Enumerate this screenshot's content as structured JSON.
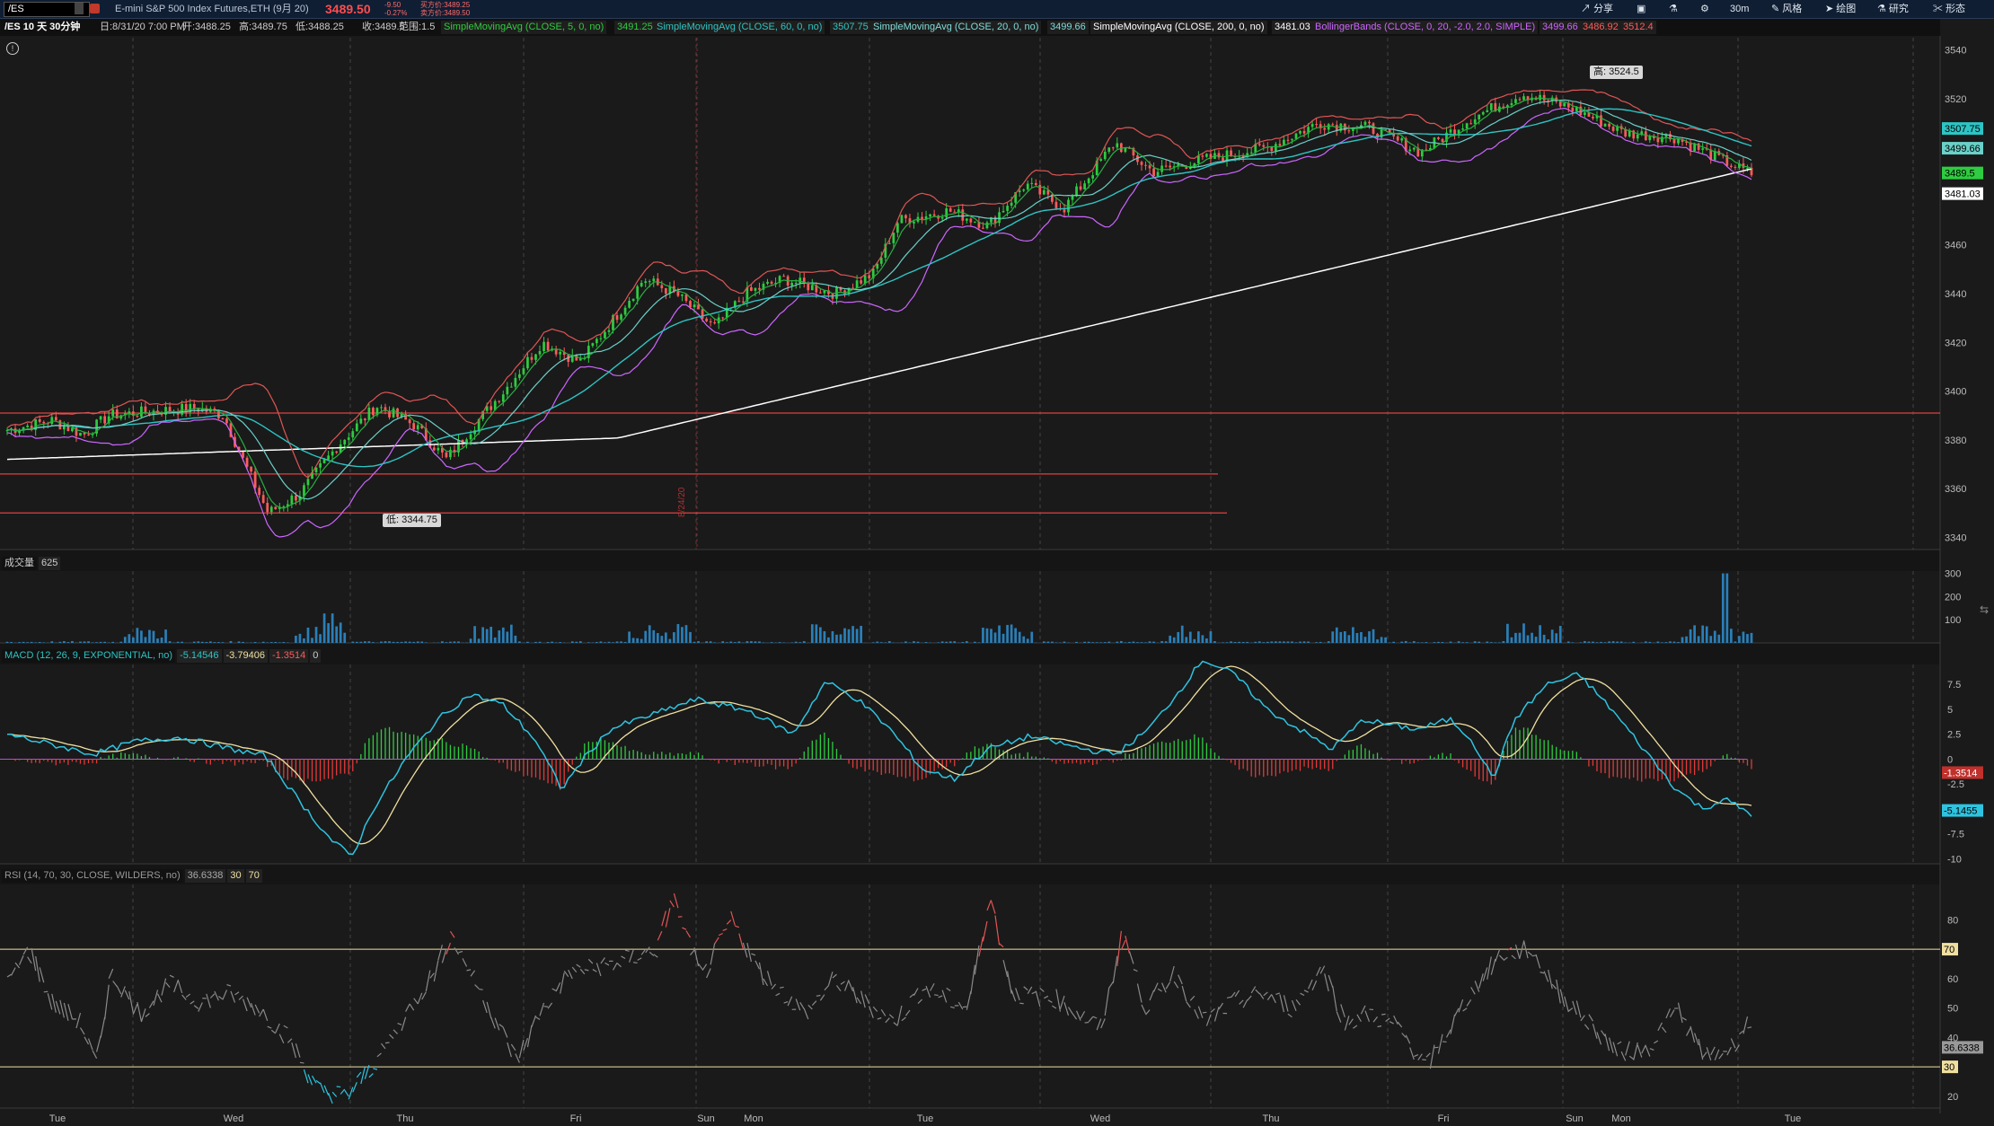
{
  "toolbar": {
    "symbol": "/ES",
    "description": "E-mini S&P 500 Index Futures,ETH (9月 20)",
    "last": "3489.50",
    "change": "-9.50",
    "change_pct": "-0.27%",
    "bid": "买方价:3489.25",
    "ask": "卖方价:3489.50",
    "buttons": [
      "分享",
      "30m",
      "风格",
      "绘图",
      "研究",
      "形态"
    ]
  },
  "header": {
    "period": "/ES 10 天 30分钟",
    "date": "日:8/31/20 7:00 PM",
    "open": "开:3488.25",
    "high": "高:3489.75",
    "low": "低:3488.25",
    "close": "收:3489.5",
    "range": "范围:1.5",
    "sma5": "SimpleMovingAvg (CLOSE, 5, 0, no)",
    "sma5_val": "3491.25",
    "sma60": "SimpleMovingAvg (CLOSE, 60, 0, no)",
    "sma60_val": "3507.75",
    "sma20": "SimpleMovingAvg (CLOSE, 20, 0, no)",
    "sma20_val": "3499.66",
    "sma200": "SimpleMovingAvg (CLOSE, 200, 0, no)",
    "sma200_val": "3481.03",
    "bb": "BollingerBands (CLOSE, 0, 20, -2.0, 2.0, SIMPLE)",
    "bb_mid": "3499.66",
    "bb_low": "3486.92",
    "bb_up": "3512.4"
  },
  "price": {
    "high_label": "高: 3524.5",
    "low_label": "低: 3344.75",
    "ticks": [
      "3540",
      "3520",
      "3500",
      "3480",
      "3460",
      "3440",
      "3420",
      "3400",
      "3380",
      "3360",
      "3340"
    ],
    "tags": [
      "3507.75",
      "3499.66",
      "3489.5",
      "3481.03"
    ],
    "vline_label": "8/24/20"
  },
  "volume": {
    "label": "成交量",
    "value": "625",
    "ticks": [
      "300",
      "200",
      "100"
    ]
  },
  "macd": {
    "label": "MACD (12, 26, 9, EXPONENTIAL, no)",
    "value": "-5.14546",
    "avg": "-3.79406",
    "diff": "-1.3514",
    "zero": "0",
    "ticks": [
      "7.5",
      "5",
      "2.5",
      "0",
      "-2.5",
      "-5",
      "-7.5",
      "-10"
    ],
    "tags": [
      "-1.3514",
      "-5.1455"
    ]
  },
  "rsi": {
    "label": "RSI (14, 70, 30, CLOSE, WILDERS, no)",
    "value": "36.6338",
    "os": "30",
    "ob": "70",
    "ticks": [
      "80",
      "70",
      "60",
      "50",
      "40",
      "30",
      "20"
    ],
    "tags": [
      "70",
      "36.6338",
      "30"
    ]
  },
  "xaxis": {
    "labels": [
      "Tue",
      "Wed",
      "Thu",
      "Fri",
      "Sun",
      "Mon",
      "Tue",
      "Wed",
      "Thu",
      "Fri",
      "Sun",
      "Mon",
      "Tue"
    ]
  },
  "chart_data": {
    "type": "line",
    "title": "/ES 10 天 30分钟",
    "ylim": [
      3335,
      3545
    ],
    "x": [
      "Tue",
      "Wed",
      "Thu",
      "Fri",
      "Sun",
      "Mon",
      "Tue",
      "Wed",
      "Thu",
      "Fri",
      "Sun",
      "Mon",
      "Tue"
    ],
    "series": [
      {
        "name": "SimpleMovingAvg (CLOSE, 200, 0, no)",
        "values": [
          3372,
          3376,
          3379,
          3380,
          3382,
          3388,
          3397,
          3410,
          3428,
          3446,
          3466,
          3479,
          3481
        ]
      },
      {
        "name": "SimpleMovingAvg (CLOSE, 20, 0, no)",
        "values": [
          3384,
          3391,
          3362,
          3386,
          3380,
          3410,
          3436,
          3440,
          3472,
          3495,
          3505,
          3512,
          3500
        ]
      },
      {
        "name": "SimpleMovingAvg (CLOSE, 5, 0, no)",
        "values": [
          3386,
          3392,
          3350,
          3390,
          3385,
          3420,
          3440,
          3442,
          3475,
          3498,
          3520,
          3510,
          3491
        ]
      }
    ],
    "annotations": [
      "高: 3524.5",
      "低: 3344.75"
    ],
    "colors": {
      "up": "#2ecc40",
      "down": "#ff5b5b",
      "sma200": "#ffffff",
      "sma20": "#2ec4c4",
      "sma60": "#cc66ff",
      "bb": "#e05555"
    }
  }
}
